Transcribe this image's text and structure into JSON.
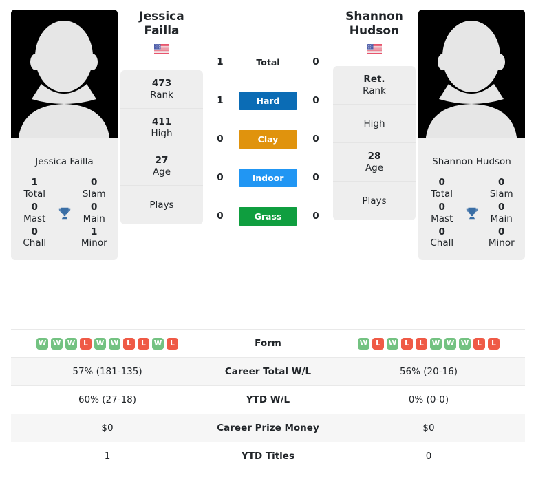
{
  "colors": {
    "hard": "#0b6cb5",
    "clay": "#e0930d",
    "indoor": "#2196f3",
    "grass": "#0f9e3f",
    "win": "#73c281",
    "loss": "#ef5a46",
    "card_bg": "#eeeeee",
    "stripe_bg": "#f6f6f6"
  },
  "players": {
    "left": {
      "name": "Jessica Failla",
      "photo_alt": "player-photo-placeholder",
      "flag": "us-flag-icon",
      "caption": "Jessica Failla",
      "awards": [
        {
          "value": "1",
          "label": "Total"
        },
        {
          "value": "0",
          "label": "Slam"
        },
        {
          "value": "0",
          "label": "Mast"
        },
        {
          "value": "0",
          "label": "Main"
        },
        {
          "value": "0",
          "label": "Chall"
        },
        {
          "value": "1",
          "label": "Minor"
        }
      ],
      "trophy_icon": "trophy-icon",
      "ranks": [
        {
          "value": "473",
          "label": "Rank"
        },
        {
          "value": "411",
          "label": "High"
        },
        {
          "value": "27",
          "label": "Age"
        },
        {
          "value": "",
          "label": "Plays"
        }
      ],
      "form": [
        "W",
        "W",
        "W",
        "L",
        "W",
        "W",
        "L",
        "L",
        "W",
        "L"
      ]
    },
    "right": {
      "name": "Shannon Hudson",
      "photo_alt": "player-photo-placeholder",
      "flag": "us-flag-icon",
      "caption": "Shannon Hudson",
      "awards": [
        {
          "value": "0",
          "label": "Total"
        },
        {
          "value": "0",
          "label": "Slam"
        },
        {
          "value": "0",
          "label": "Mast"
        },
        {
          "value": "0",
          "label": "Main"
        },
        {
          "value": "0",
          "label": "Chall"
        },
        {
          "value": "0",
          "label": "Minor"
        }
      ],
      "trophy_icon": "trophy-icon",
      "ranks": [
        {
          "value": "Ret.",
          "label": "Rank"
        },
        {
          "value": "",
          "label": "High"
        },
        {
          "value": "28",
          "label": "Age"
        },
        {
          "value": "",
          "label": "Plays"
        }
      ],
      "form": [
        "W",
        "L",
        "W",
        "L",
        "L",
        "W",
        "W",
        "W",
        "L",
        "L"
      ]
    }
  },
  "surfaces": [
    {
      "label": "Total",
      "left": "1",
      "right": "0",
      "color": "transparent",
      "plain": true
    },
    {
      "label": "Hard",
      "left": "1",
      "right": "0",
      "color": "#0b6cb5",
      "plain": false
    },
    {
      "label": "Clay",
      "left": "0",
      "right": "0",
      "color": "#e0930d",
      "plain": false
    },
    {
      "label": "Indoor",
      "left": "0",
      "right": "0",
      "color": "#2196f3",
      "plain": false
    },
    {
      "label": "Grass",
      "left": "0",
      "right": "0",
      "color": "#0f9e3f",
      "plain": false
    }
  ],
  "stats": [
    {
      "label": "Form",
      "left": "",
      "right": "",
      "is_form": true
    },
    {
      "label": "Career Total W/L",
      "left": "57% (181-135)",
      "right": "56% (20-16)",
      "is_form": false
    },
    {
      "label": "YTD W/L",
      "left": "60% (27-18)",
      "right": "0% (0-0)",
      "is_form": false
    },
    {
      "label": "Career Prize Money",
      "left": "$0",
      "right": "$0",
      "is_form": false
    },
    {
      "label": "YTD Titles",
      "left": "1",
      "right": "0",
      "is_form": false
    }
  ]
}
